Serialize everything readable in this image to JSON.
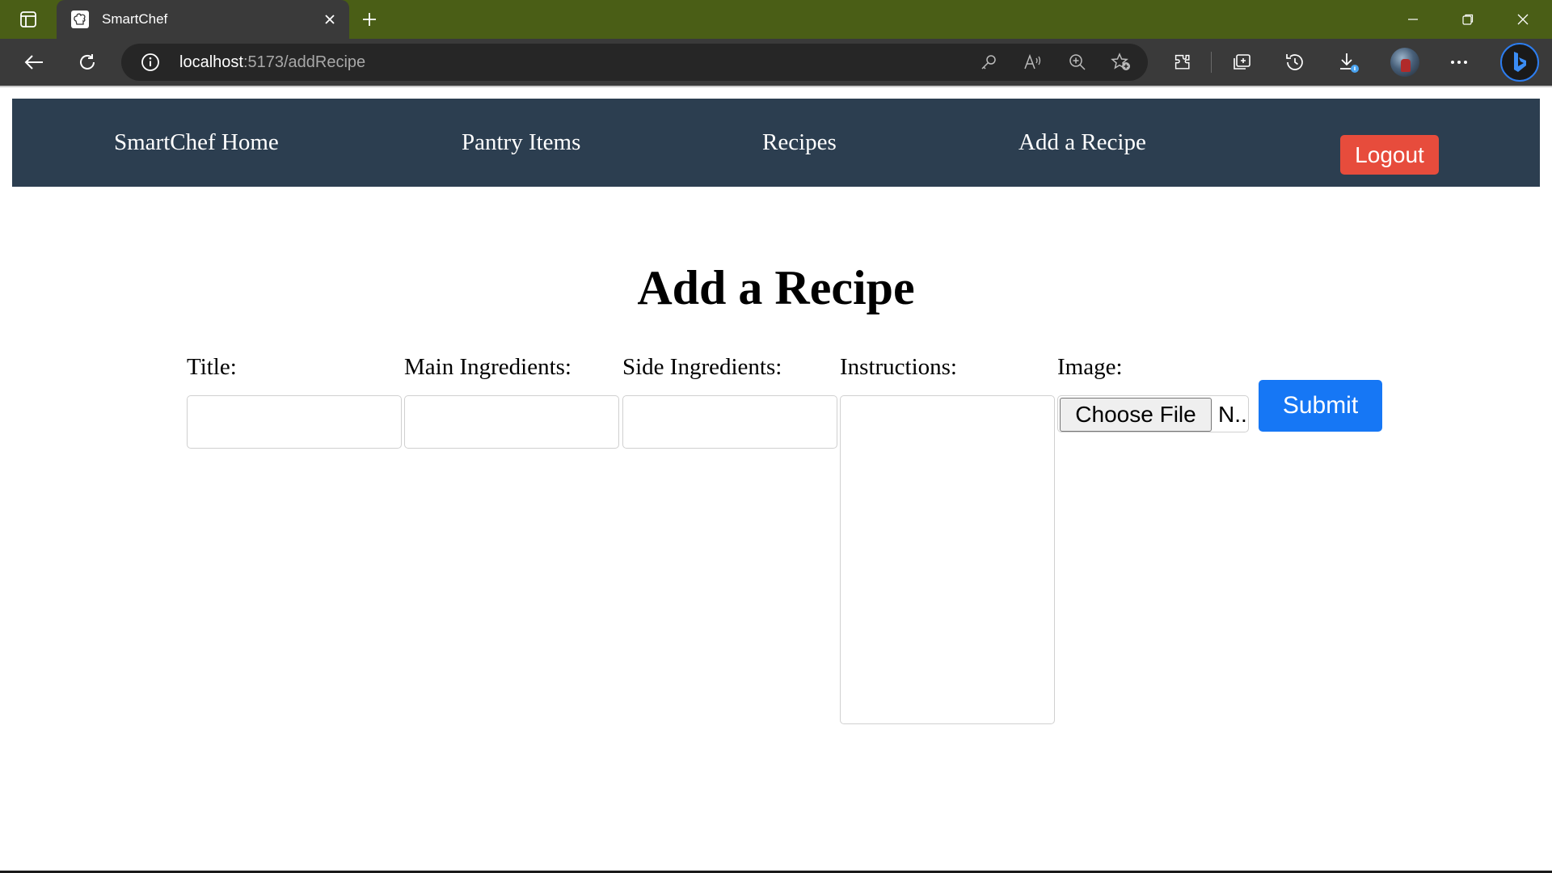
{
  "browser": {
    "tab_title": "SmartChef",
    "url_host": "localhost",
    "url_path": ":5173/addRecipe"
  },
  "navbar": {
    "links": [
      "SmartChef Home",
      "Pantry Items",
      "Recipes",
      "Add a Recipe"
    ],
    "logout_label": "Logout"
  },
  "form": {
    "heading": "Add a Recipe",
    "labels": {
      "title": "Title:",
      "main_ingredients": "Main Ingredients:",
      "side_ingredients": "Side Ingredients:",
      "instructions": "Instructions:",
      "image": "Image:"
    },
    "values": {
      "title": "",
      "main_ingredients": "",
      "side_ingredients": "",
      "instructions": ""
    },
    "file_button_label": "Choose File",
    "file_status": "N..",
    "submit_label": "Submit"
  },
  "colors": {
    "titlebar": "#4a5e16",
    "navbar": "#2c3e50",
    "logout": "#e74c3c",
    "submit": "#1677f5"
  }
}
